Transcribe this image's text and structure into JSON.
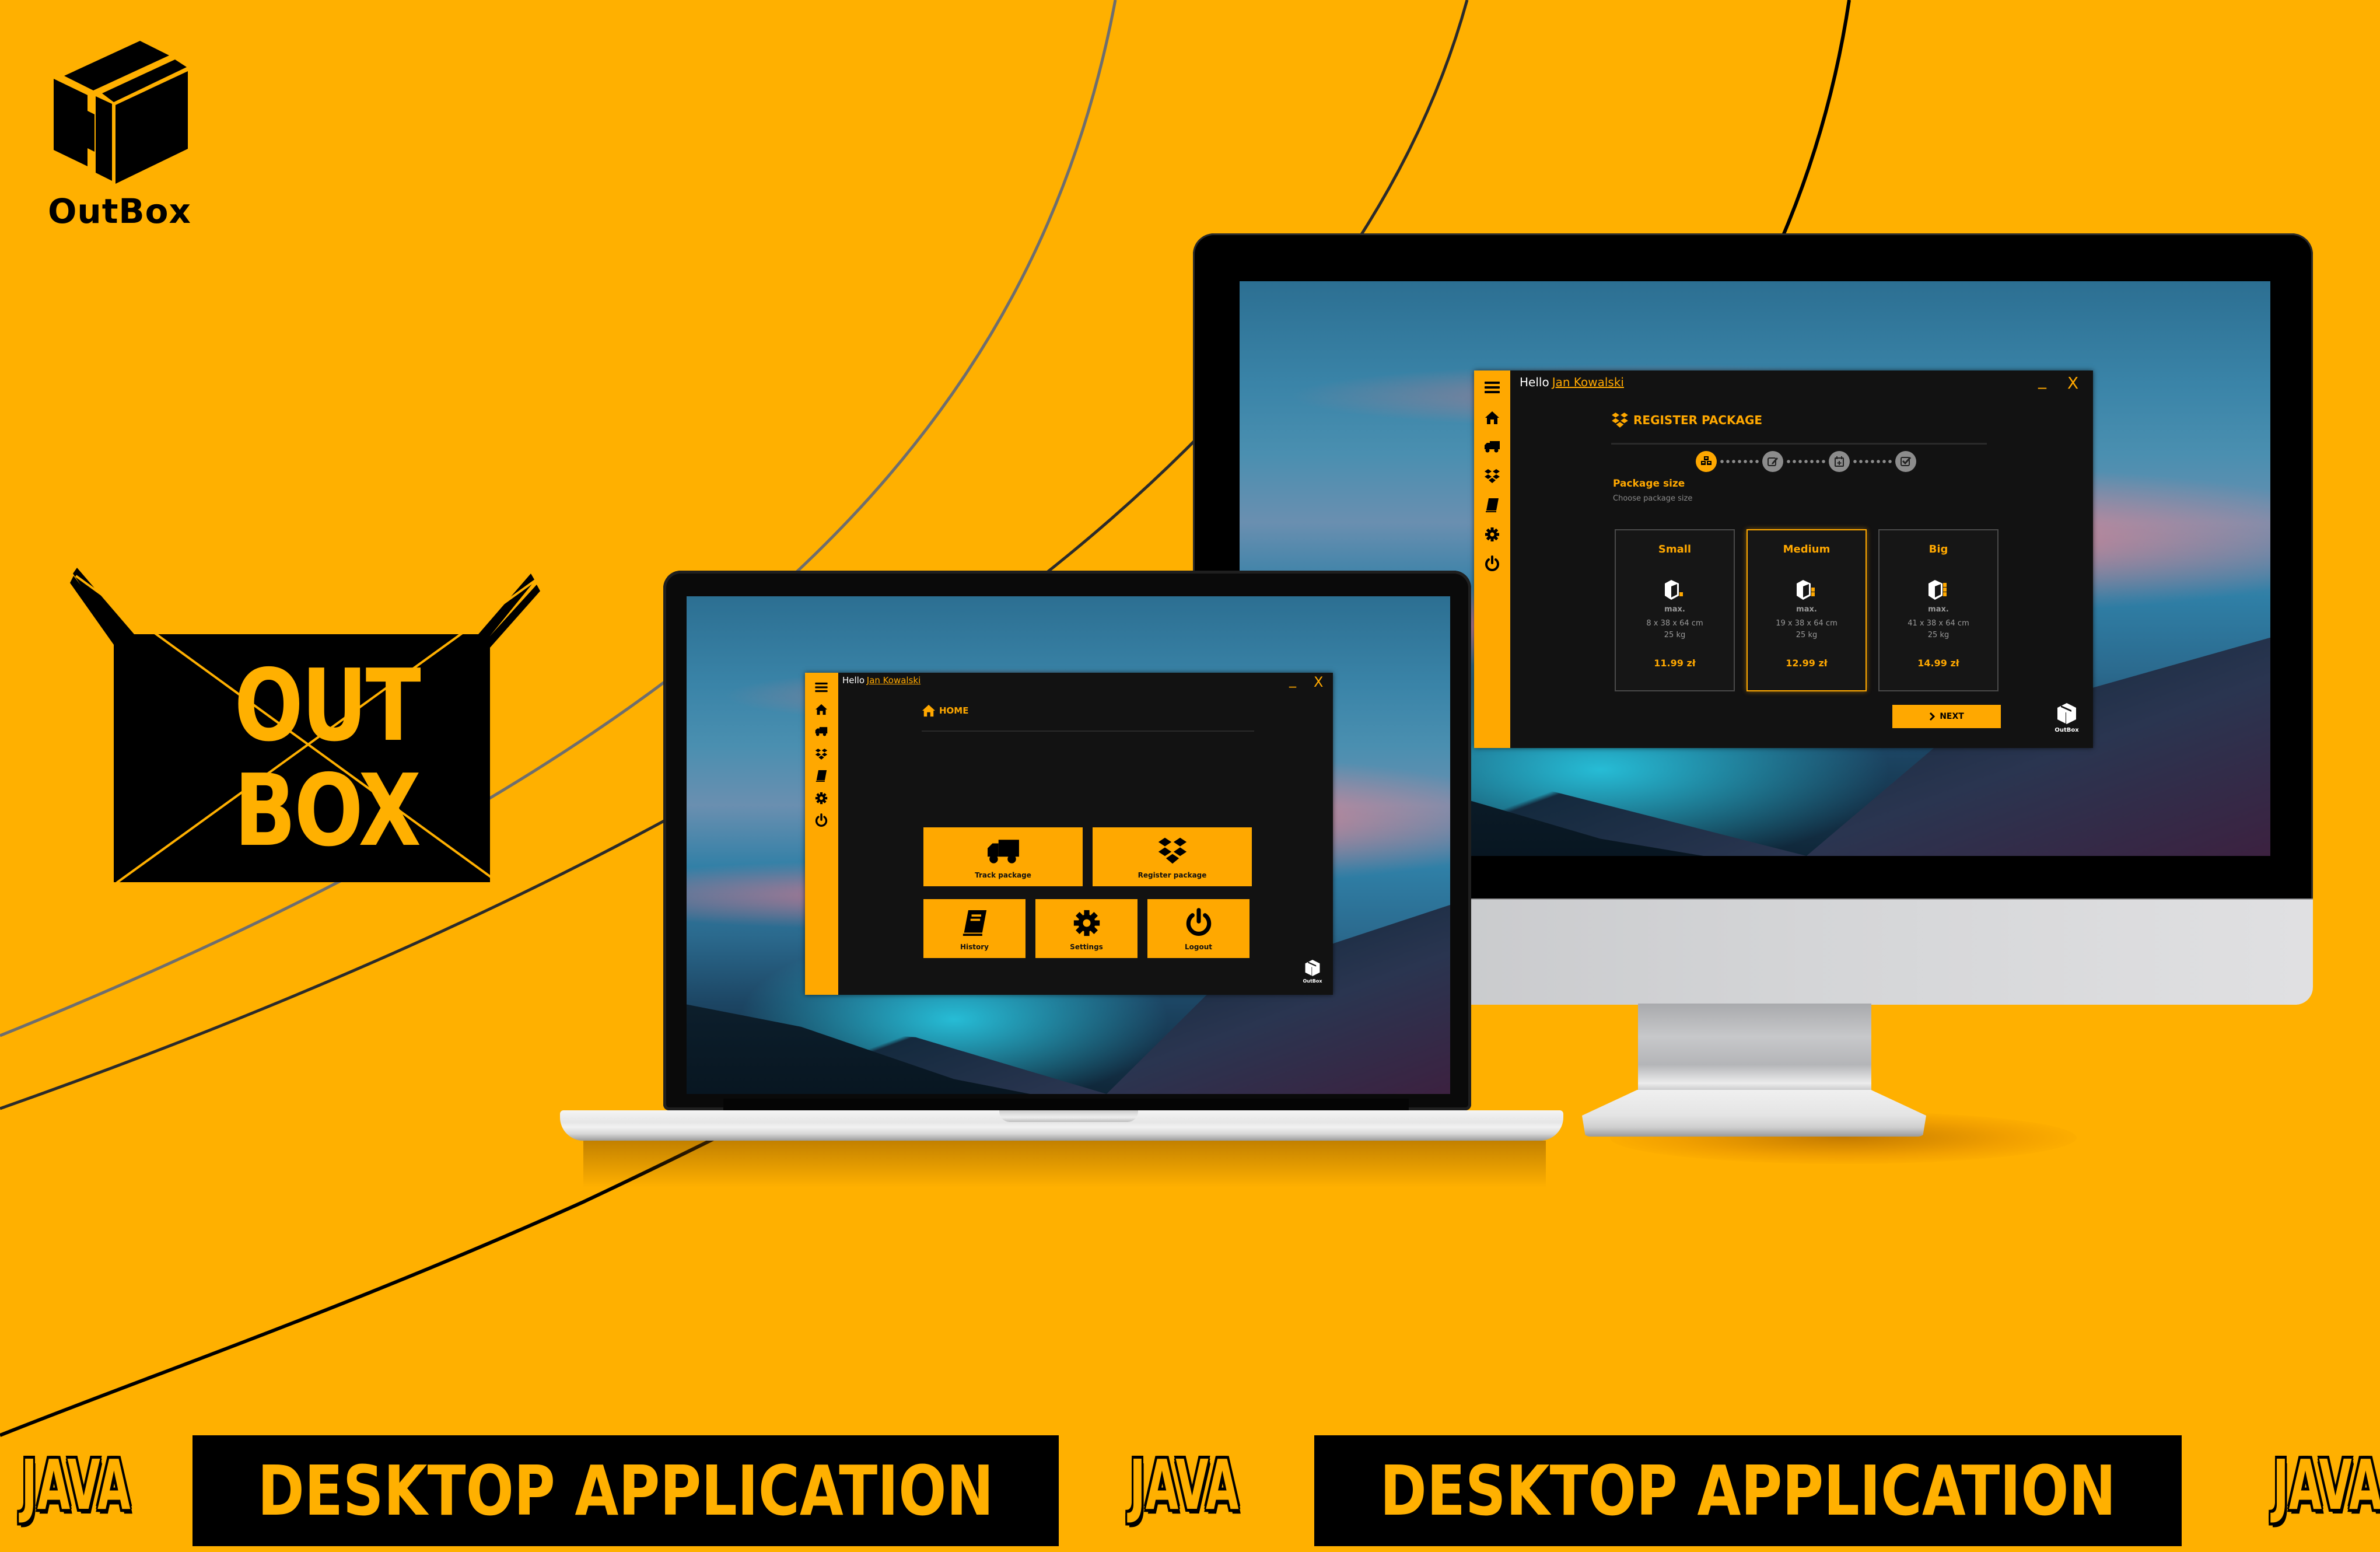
{
  "brand": {
    "name": "OutBox",
    "icon": "package-box-icon",
    "envelope_logo": {
      "line1": "OUT",
      "line2": "BOX",
      "icon": "envelope-x-icon"
    }
  },
  "colors": {
    "background": "#FFB000",
    "accent": "#FFA800",
    "app_background": "#121212",
    "step_inactive": "#8c8c8c",
    "muted_text": "#9a9a9a"
  },
  "monitor_app": {
    "greeting": "Hello",
    "user_name": "Jan Kowalski",
    "window_controls": {
      "minimize": "_",
      "close": "X"
    },
    "sidebar": [
      {
        "icon": "menu-icon",
        "label": "Menu"
      },
      {
        "icon": "home-icon",
        "label": "Home"
      },
      {
        "icon": "truck-icon",
        "label": "Track package"
      },
      {
        "icon": "dropbox-icon",
        "label": "Register package"
      },
      {
        "icon": "book-icon",
        "label": "History"
      },
      {
        "icon": "gear-icon",
        "label": "Settings"
      },
      {
        "icon": "power-icon",
        "label": "Logout"
      }
    ],
    "page_title": "REGISTER PACKAGE",
    "page_icon": "dropbox-icon",
    "stepper": {
      "current_step": 1,
      "total_steps": 4,
      "steps": [
        {
          "icon": "cubes-icon",
          "state": "active"
        },
        {
          "icon": "edit-icon",
          "state": "inactive"
        },
        {
          "icon": "calendar-plus-icon",
          "state": "inactive"
        },
        {
          "icon": "checkbox-icon",
          "state": "inactive"
        }
      ]
    },
    "section_title": "Package size",
    "section_subtitle": "Choose package size",
    "sizes": [
      {
        "name": "Small",
        "max_label": "max.",
        "dimensions": "8 x 38 x 64 cm",
        "weight": "25 kg",
        "price": "11.99 zł",
        "selected": false,
        "fill_level": 1
      },
      {
        "name": "Medium",
        "max_label": "max.",
        "dimensions": "19 x 38 x 64 cm",
        "weight": "25 kg",
        "price": "12.99 zł",
        "selected": true,
        "fill_level": 2
      },
      {
        "name": "Big",
        "max_label": "max.",
        "dimensions": "41 x  38 x  64 cm",
        "weight": "25 kg",
        "price": "14.99 zł",
        "selected": false,
        "fill_level": 3
      }
    ],
    "next_button": "NEXT",
    "brand_mini": "OutBox"
  },
  "laptop_app": {
    "greeting": "Hello",
    "user_name": "Jan Kowalski",
    "window_controls": {
      "minimize": "_",
      "close": "X"
    },
    "page_title": "HOME",
    "page_icon": "home-icon",
    "tiles": [
      {
        "label": "Track package",
        "icon": "truck-icon"
      },
      {
        "label": "Register package",
        "icon": "dropbox-icon"
      },
      {
        "label": "History",
        "icon": "book-icon"
      },
      {
        "label": "Settings",
        "icon": "gear-icon"
      },
      {
        "label": "Logout",
        "icon": "power-icon"
      }
    ],
    "brand_mini": "OutBox"
  },
  "banner": {
    "items": [
      "JAVA",
      "DESKTOP APPLICATION",
      "JAVA",
      "DESKTOP APPLICATION",
      "JAVA"
    ]
  }
}
